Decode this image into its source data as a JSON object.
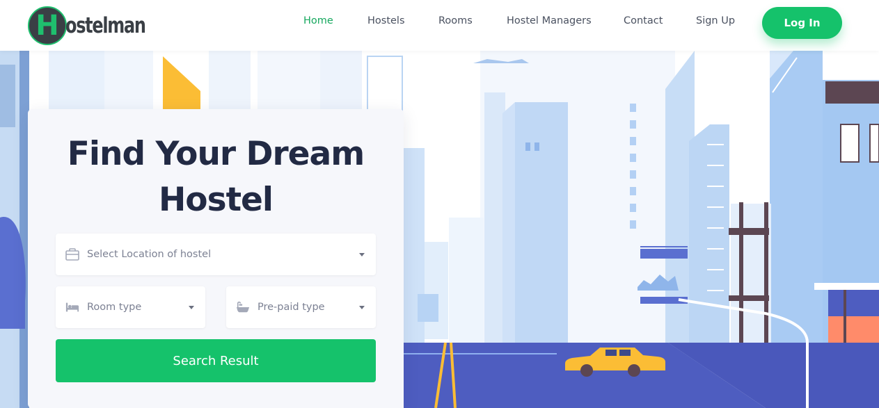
{
  "brand": {
    "badge_letter": "H",
    "name_rest": "ostelman",
    "color_primary": "#15c26b",
    "color_dark": "#3a3f45"
  },
  "nav": {
    "items": [
      {
        "label": "Home",
        "active": true
      },
      {
        "label": "Hostels",
        "active": false
      },
      {
        "label": "Rooms",
        "active": false
      },
      {
        "label": "Hostel Managers",
        "active": false
      },
      {
        "label": "Contact",
        "active": false
      },
      {
        "label": "Sign Up",
        "active": false
      }
    ],
    "login_label": "Log In"
  },
  "search_card": {
    "title_line1": "Find Your Dream",
    "title_line2": "Hostel",
    "location_placeholder": "Select Location of hostel",
    "location_icon": "briefcase-icon",
    "room_type_placeholder": "Room type",
    "room_type_icon": "bed-icon",
    "prepaid_type_placeholder": "Pre-paid type",
    "prepaid_type_icon": "bathtub-icon",
    "search_button_label": "Search Result"
  }
}
